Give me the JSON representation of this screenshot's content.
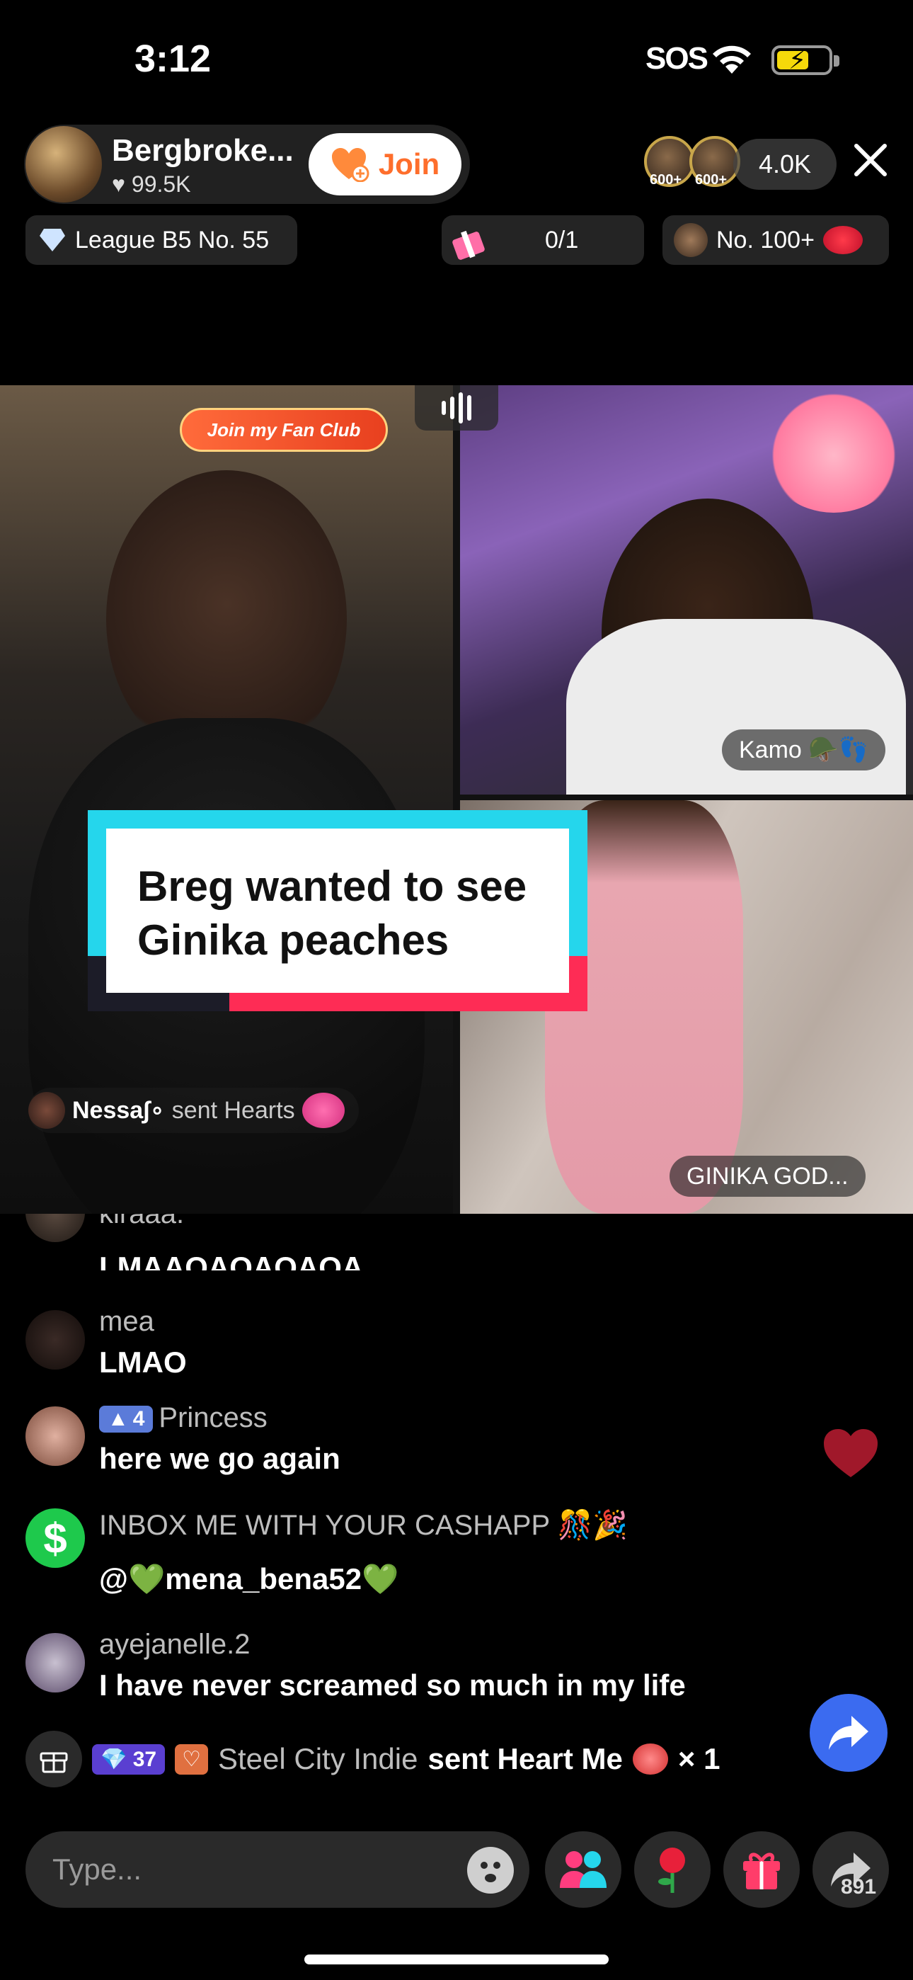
{
  "status_bar": {
    "time": "3:12",
    "carrier": "SOS"
  },
  "host": {
    "name": "Bergbroke...",
    "likes": "99.5K",
    "join_label": "Join"
  },
  "viewers": {
    "count": "4.0K",
    "badge_a": "600+",
    "badge_b": "600+"
  },
  "pills": {
    "league": "League B5 No. 55",
    "progress": "0/1",
    "rank": "No. 100+"
  },
  "video": {
    "fan_club_label": "Join my Fan Club",
    "tr_name": "Kamo",
    "br_name": "GINIKA GOD...",
    "gift_user": "Nessa∫∘",
    "gift_action": "sent Hearts"
  },
  "caption": {
    "line1": "Breg wanted to see",
    "line2": "Ginika peaches"
  },
  "comments": [
    {
      "user": "kiraaa.",
      "message": "LMAAOAOAOAOA"
    },
    {
      "user": "mea",
      "message": "LMAO"
    },
    {
      "user": "Princess",
      "level": "4",
      "message": "here we go again"
    },
    {
      "user": "INBOX ME WITH YOUR CASHAPP",
      "message": "@💚mena_bena52💚"
    },
    {
      "user": "ayejanelle.2",
      "message": "I have never screamed so much in my life"
    }
  ],
  "gift_row": {
    "level": "37",
    "user": "Steel City Indie",
    "action": "sent Heart Me",
    "count": "× 1"
  },
  "bottom_bar": {
    "input_placeholder": "Type...",
    "share_count": "891"
  },
  "colors": {
    "accent_red": "#fe2c55",
    "accent_cyan": "#25d6ec",
    "join_orange": "#fe6e2c",
    "share_blue": "#3b6bf0"
  }
}
